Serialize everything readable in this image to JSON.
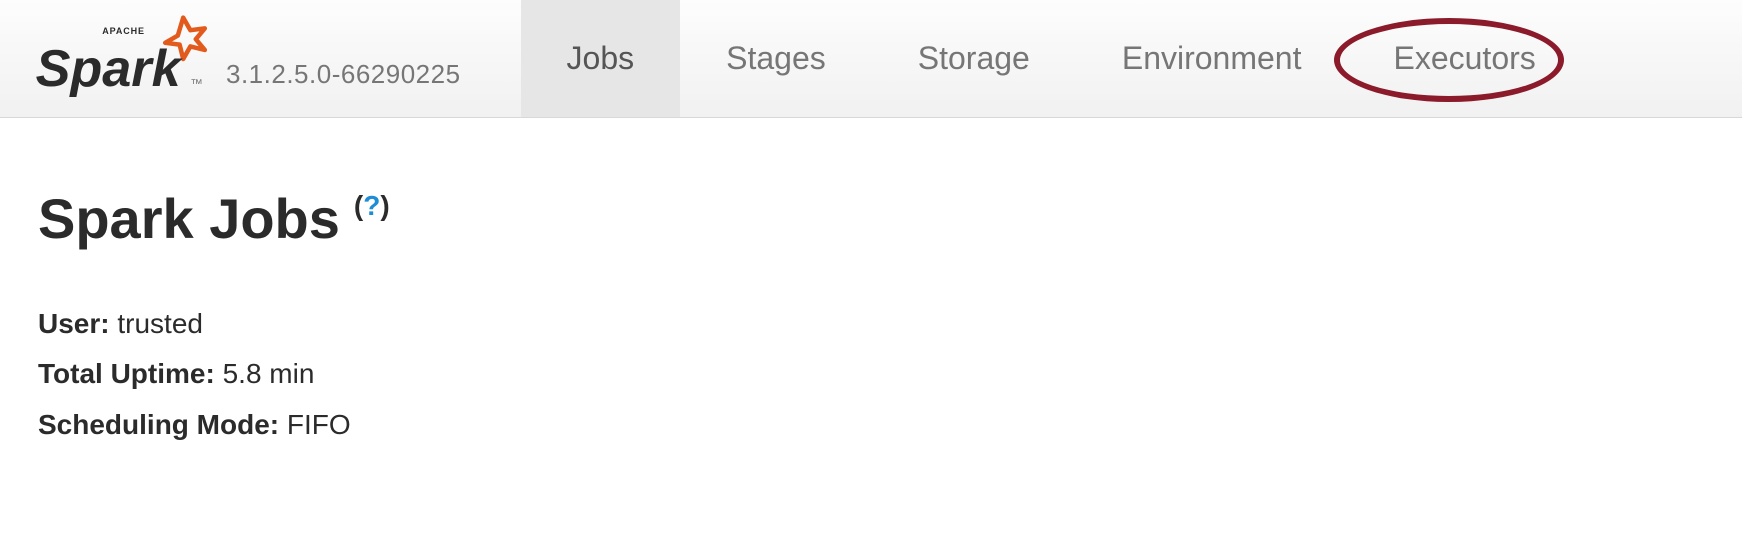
{
  "header": {
    "brand_apache": "APACHE",
    "version": "3.1.2.5.0-66290225"
  },
  "nav": {
    "tabs": [
      {
        "label": "Jobs",
        "active": true
      },
      {
        "label": "Stages",
        "active": false
      },
      {
        "label": "Storage",
        "active": false
      },
      {
        "label": "Environment",
        "active": false
      },
      {
        "label": "Executors",
        "active": false
      }
    ]
  },
  "main": {
    "title": "Spark Jobs",
    "help_symbol": "(?)",
    "summary": {
      "user_label": "User:",
      "user_value": "trusted",
      "uptime_label": "Total Uptime:",
      "uptime_value": "5.8 min",
      "scheduling_label": "Scheduling Mode:",
      "scheduling_value": "FIFO"
    }
  }
}
